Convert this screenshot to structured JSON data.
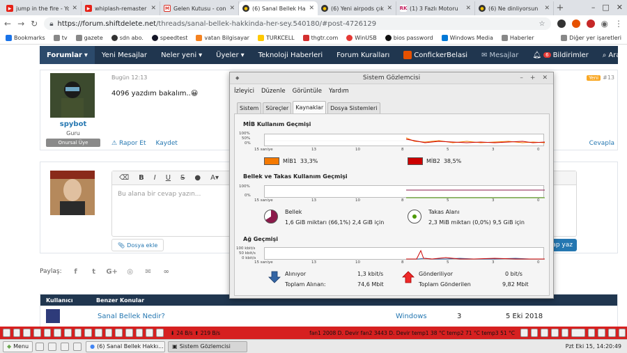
{
  "browser": {
    "tabs": [
      {
        "title": "jump in the fire - Yo",
        "icon": "youtube-icon",
        "color": "#e62117",
        "active": false
      },
      {
        "title": "whiplash-remaster",
        "icon": "youtube-icon",
        "color": "#e62117",
        "active": false
      },
      {
        "title": "Gelen Kutusu - con",
        "icon": "gmail-icon",
        "color": "#d93025",
        "active": false
      },
      {
        "title": "(6) Sanal Bellek Ha",
        "icon": "sdn-icon",
        "color": "#333333",
        "active": true
      },
      {
        "title": "(6) Yeni airpods çık",
        "icon": "sdn-icon",
        "color": "#333333",
        "active": false
      },
      {
        "title": "(1) 3 Fazlı Motoru",
        "icon": "rk-icon",
        "color": "#c2185b",
        "active": false
      },
      {
        "title": "(6) Ne dinliyorsun",
        "icon": "sdn-icon",
        "color": "#333333",
        "active": false
      }
    ],
    "url_host": "https://forum.shiftdelete.net",
    "url_path": "/threads/sanal-bellek-hakkinda-her-sey.540180/#post-4726129",
    "bookmarks": [
      {
        "label": "Bookmarks",
        "color": "#1a73e8"
      },
      {
        "label": "tv",
        "color": "#888888"
      },
      {
        "label": "gazete",
        "color": "#888888"
      },
      {
        "label": "sdn abo.",
        "color": "#333333"
      },
      {
        "label": "speedtest",
        "color": "#141526"
      },
      {
        "label": "vatan Bilgisayar",
        "color": "#f58220"
      },
      {
        "label": "TURKCELL",
        "color": "#ffc900"
      },
      {
        "label": "thgtr.com",
        "color": "#d32f2f"
      },
      {
        "label": "WinUSB",
        "color": "#e53935"
      },
      {
        "label": "bios password",
        "color": "#111111"
      },
      {
        "label": "Windows Media",
        "color": "#0078d7"
      },
      {
        "label": "Haberler",
        "color": "#888888"
      }
    ],
    "other_bookmarks": "Diğer yer işaretleri"
  },
  "forum_nav": {
    "items": [
      "Forumlar",
      "Yeni Mesajlar",
      "Neler yeni",
      "Üyeler",
      "Teknoloji Haberleri",
      "Forum Kuralları"
    ],
    "user": "ConfickerBelasi",
    "messages": "Mesajlar",
    "notifications": "Bildirimler",
    "notif_count": "6",
    "search": "Ara"
  },
  "post": {
    "date": "Bugün 12:13",
    "text": "4096 yazdım bakalım..😀",
    "username": "spybot",
    "role": "Guru",
    "badge": "Onursal Üye",
    "number": "#13",
    "new_label": "Yeni",
    "report": "Rapor Et",
    "save": "Kaydet",
    "reply": "Cevapla"
  },
  "reply_box": {
    "placeholder": "Bu alana bir cevap yazın...",
    "attach": "Dosya ekle",
    "send": "Cevap yaz"
  },
  "share": {
    "label": "Paylaş:"
  },
  "similar": {
    "col_user": "Kullanıcı",
    "col_topic": "Benzer Konular",
    "row_title": "Sanal Bellek Nedir?",
    "row_forum": "Windows",
    "row_count": "3",
    "row_date": "5 Eki 2018"
  },
  "system_monitor": {
    "title": "Sistem Gözlemcisi",
    "menu": [
      "İzleyici",
      "Düzenle",
      "Görüntüle",
      "Yardım"
    ],
    "tabs": [
      "Sistem",
      "Süreçler",
      "Kaynaklar",
      "Dosya Sistemleri"
    ],
    "active_tab": "Kaynaklar",
    "cpu": {
      "title": "MİB Kullanım Geçmişi",
      "y_labels": [
        "100%",
        "50%",
        "0%"
      ],
      "x_labels": [
        "15 saniye",
        "13",
        "10",
        "8",
        "5",
        "3",
        "0"
      ],
      "cpu1_label": "MİB1",
      "cpu1_value": "33,3%",
      "cpu1_color": "#f57900",
      "cpu2_label": "MİB2",
      "cpu2_value": "38,5%",
      "cpu2_color": "#cc0000"
    },
    "memory": {
      "title": "Bellek ve Takas Kullanım Geçmişi",
      "y_labels": [
        "100%",
        "0%"
      ],
      "x_labels": [
        "15 saniye",
        "13",
        "10",
        "8",
        "5",
        "3",
        "0"
      ],
      "mem_label": "Bellek",
      "mem_detail": "1,6 GiB miktarı (66,1%) 2,4 GiB için",
      "mem_percent": 66.1,
      "mem_color": "#8b1a4a",
      "swap_label": "Takas Alanı",
      "swap_detail": "2,3 MiB miktarı (0,0%) 9,5 GiB için",
      "swap_color": "#4e9a06"
    },
    "network": {
      "title": "Ağ Geçmişi",
      "y_labels": [
        "100 kbit/s",
        "50 kbit/s",
        "0 kbit/s"
      ],
      "x_labels": [
        "15 saniye",
        "13",
        "10",
        "8",
        "5",
        "3",
        "0"
      ],
      "recv_label": "Alınıyor",
      "recv_rate": "1,3 kbit/s",
      "recv_total_label": "Toplam Alınan:",
      "recv_total": "74,6 Mbit",
      "recv_color": "#3465a4",
      "send_label": "Gönderiliyor",
      "send_rate": "0 bit/s",
      "send_total_label": "Toplam Gönderilen",
      "send_total": "9,82 Mbit",
      "send_color": "#cc0000"
    }
  },
  "taskbar_top": {
    "net": "24 B/s",
    "net2": "219 B/s",
    "sensors": "fan1 2008 D. Devir fan2 3443 D. Devir temp1 38 °C temp2 71 °C temp3 51 °C"
  },
  "panel": {
    "menu": "Menu",
    "windows": [
      "(6) Sanal Bellek Hakkı...",
      "Sistem Gözlemcisi"
    ],
    "clock": "Pzt Eki 15, 14:20:49"
  }
}
